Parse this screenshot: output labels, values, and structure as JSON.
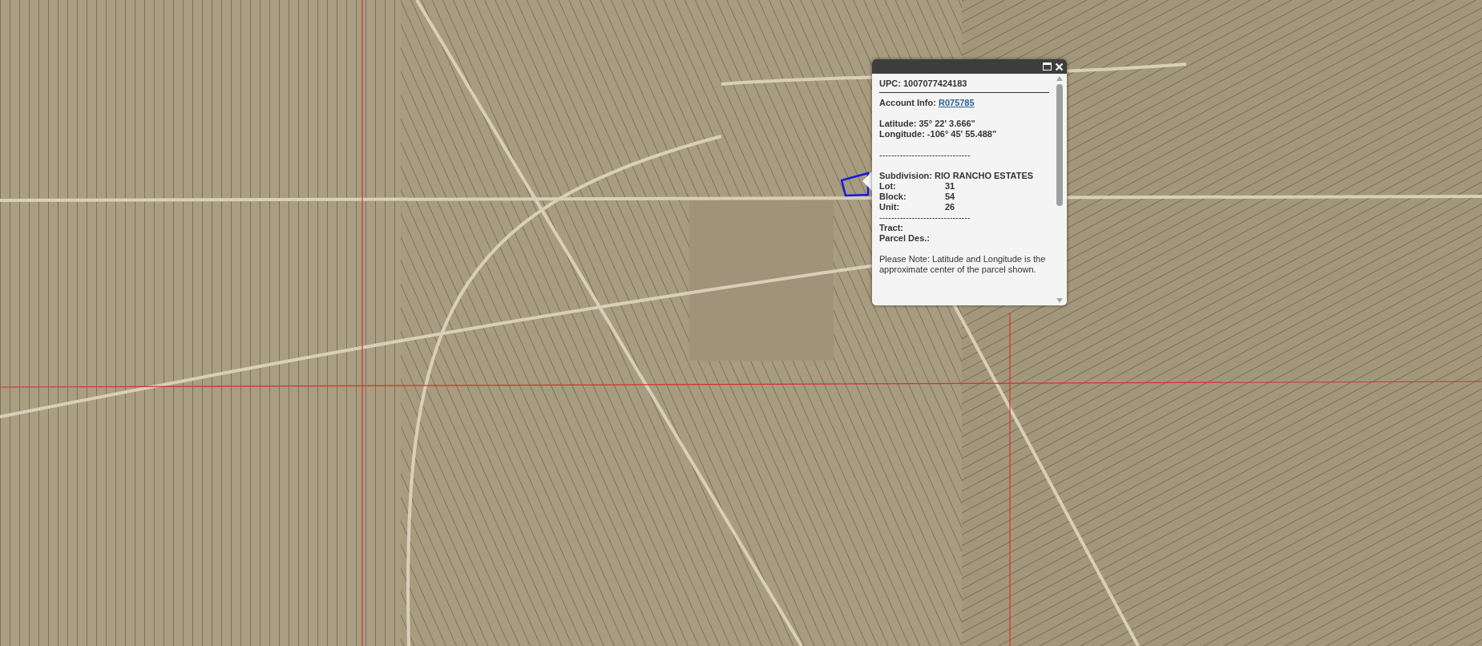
{
  "popup": {
    "rows": [
      {
        "kind": "heading",
        "text": "UPC: 1007077424183"
      },
      {
        "kind": "rule"
      },
      {
        "kind": "link",
        "label": "Account Info:",
        "link": "R075785"
      },
      {
        "kind": "gap"
      },
      {
        "kind": "bold",
        "text": "Latitude: 35° 22' 3.666\""
      },
      {
        "kind": "bold",
        "text": "Longitude: -106° 45' 55.488\""
      },
      {
        "kind": "gap"
      },
      {
        "kind": "dashes",
        "text": "-------------------------------"
      },
      {
        "kind": "gap"
      },
      {
        "kind": "bold",
        "text": "Subdivision: RIO RANCHO ESTATES"
      },
      {
        "kind": "pair",
        "label": "Lot:",
        "value": "31"
      },
      {
        "kind": "pair",
        "label": "Block:",
        "value": "54"
      },
      {
        "kind": "pair",
        "label": "Unit:",
        "value": "26"
      },
      {
        "kind": "dashes",
        "text": "-------------------------------"
      },
      {
        "kind": "bold",
        "text": "Tract:"
      },
      {
        "kind": "bold",
        "text": "Parcel Des.:"
      },
      {
        "kind": "gap"
      },
      {
        "kind": "note",
        "text": "Please Note: Latitude and Longitude is the approximate center of the parcel shown."
      }
    ]
  }
}
